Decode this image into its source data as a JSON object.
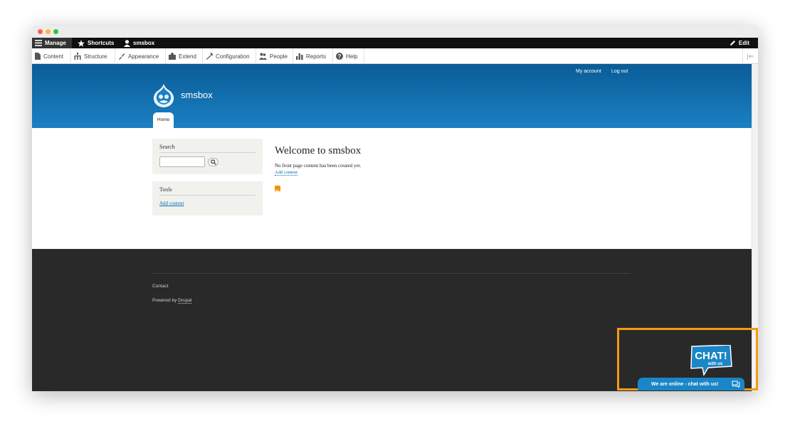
{
  "window": {
    "traffic_lights": [
      "close",
      "minimize",
      "zoom"
    ]
  },
  "toolbar": {
    "manage_label": "Manage",
    "shortcuts_label": "Shortcuts",
    "user_label": "smsbox",
    "edit_label": "Edit"
  },
  "tray": {
    "items": [
      {
        "label": "Content",
        "icon": "document-icon"
      },
      {
        "label": "Structure",
        "icon": "sitemap-icon"
      },
      {
        "label": "Appearance",
        "icon": "brush-icon"
      },
      {
        "label": "Extend",
        "icon": "puzzle-icon"
      },
      {
        "label": "Configuration",
        "icon": "wrench-icon"
      },
      {
        "label": "People",
        "icon": "people-icon"
      },
      {
        "label": "Reports",
        "icon": "bar-chart-icon"
      },
      {
        "label": "Help",
        "icon": "help-icon"
      }
    ]
  },
  "header": {
    "my_account": "My account",
    "log_out": "Log out",
    "site_name": "smsbox",
    "home_tab": "Home"
  },
  "sidebar": {
    "search_title": "Search",
    "tools_title": "Tools",
    "tools_link": "Add content"
  },
  "content": {
    "title": "Welcome to smsbox",
    "message": "No front page content has been created yet.",
    "add_content": "Add content"
  },
  "footer": {
    "contact": "Contact",
    "powered_by": "Powered by",
    "drupal_link": "Drupal"
  },
  "chat": {
    "bubble_text": "CHAT!",
    "bubble_subtext": "with us",
    "bar_text": "We are online - chat with us!"
  },
  "colors": {
    "header_blue": "#1b80c3",
    "footer_dark": "#292929",
    "highlight_orange": "#f59a12",
    "chat_blue": "#1a86c7"
  }
}
